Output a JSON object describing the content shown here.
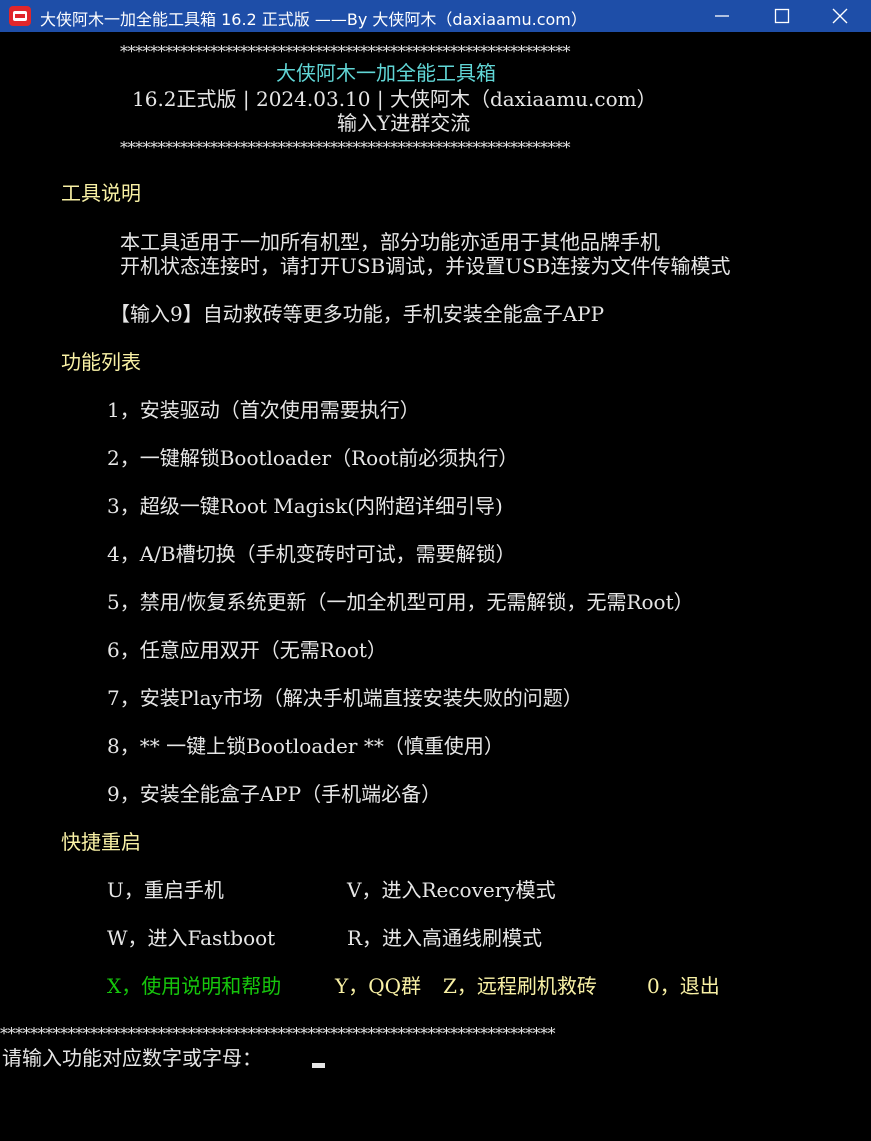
{
  "window": {
    "title": "大侠阿木一加全能工具箱 16.2 正式版 ——By 大侠阿木（daxiaamu.com）"
  },
  "header": {
    "stars": "************************************************************",
    "app_name": "大侠阿木一加全能工具箱",
    "version_line": "16.2正式版 | 2024.03.10 | 大侠阿木（daxiaamu.com）",
    "group_line": "输入Y进群交流"
  },
  "intro": {
    "heading": "工具说明",
    "line1": "本工具适用于一加所有机型，部分功能亦适用于其他品牌手机",
    "line2": "开机状态连接时，请打开USB调试，并设置USB连接为文件传输模式",
    "line3": "【输入9】自动救砖等更多功能，手机安装全能盒子APP"
  },
  "features": {
    "heading": "功能列表",
    "items": [
      "1，安装驱动（首次使用需要执行）",
      "2，一键解锁Bootloader（Root前必须执行）",
      "3，超级一键Root Magisk(内附超详细引导)",
      "4，A/B槽切换（手机变砖时可试，需要解锁）",
      "5，禁用/恢复系统更新（一加全机型可用，无需解锁，无需Root）",
      "6，任意应用双开（无需Root）",
      "7，安装Play市场（解决手机端直接安装失败的问题）",
      "8，** 一键上锁Bootloader **（慎重使用）",
      "9，安装全能盒子APP（手机端必备）"
    ]
  },
  "reboot": {
    "heading": "快捷重启",
    "u": "U，重启手机",
    "v": "V，进入Recovery模式",
    "w": "W，进入Fastboot",
    "r": "R，进入高通线刷模式",
    "x": "X，使用说明和帮助",
    "y": "Y，QQ群",
    "z": "Z，远程刷机救砖",
    "zero": "0，退出"
  },
  "footer": {
    "stars": "**************************************************************************",
    "prompt": "请输入功能对应数字或字母："
  },
  "colors": {
    "titlebar": "#1e4ea8",
    "heading_yellow": "#f9f1a5",
    "title_cyan": "#61d6d6",
    "help_green": "#16c60c"
  }
}
